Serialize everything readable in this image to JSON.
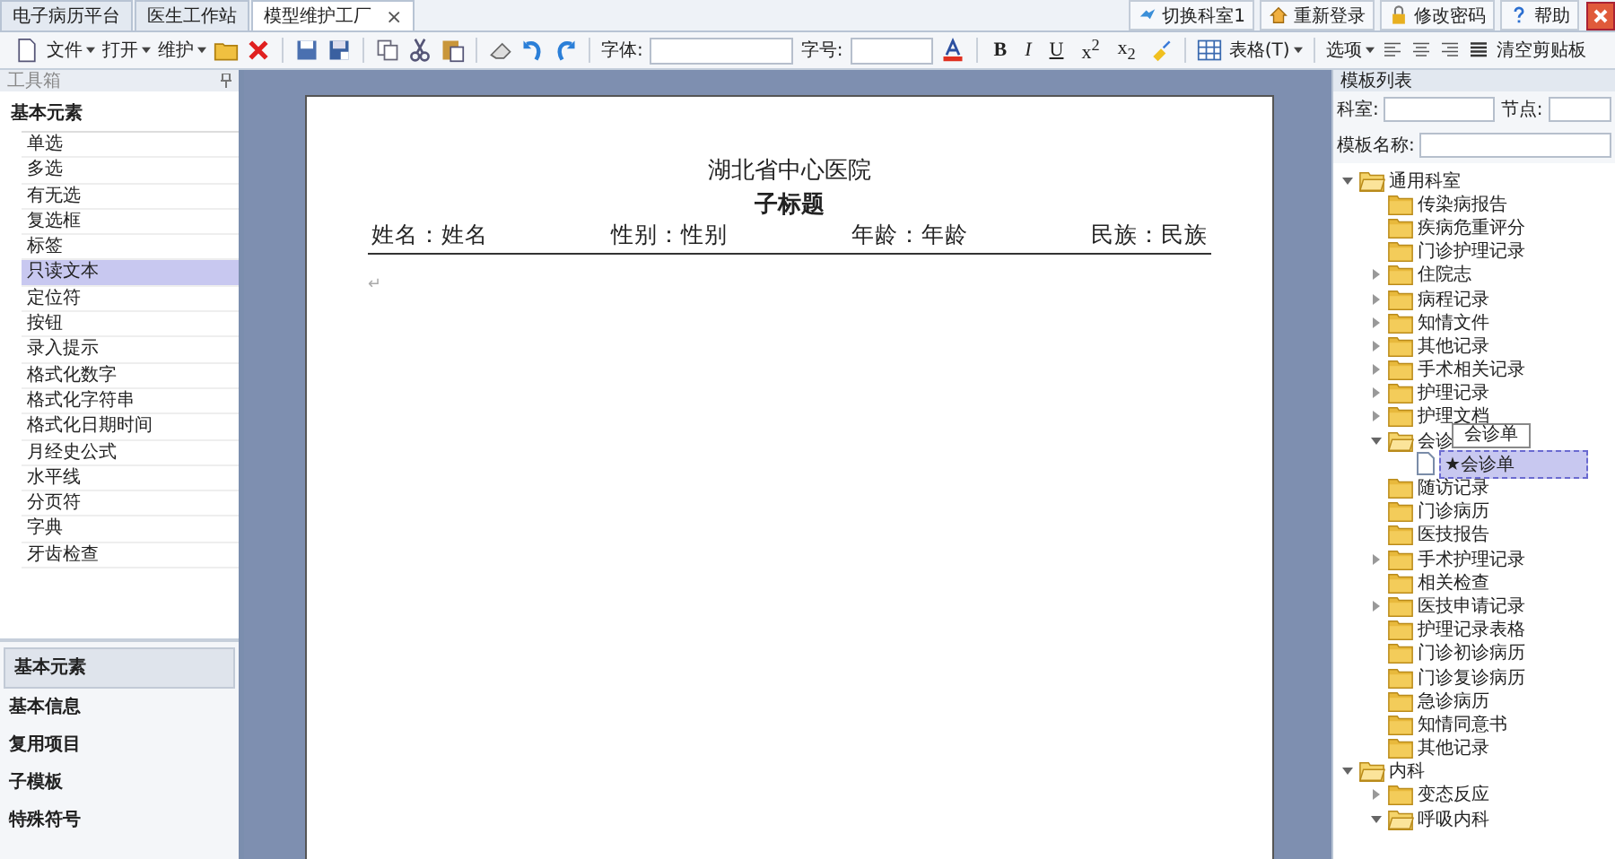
{
  "tabs": [
    {
      "label": "电子病历平台",
      "selected": false
    },
    {
      "label": "医生工作站",
      "selected": false
    },
    {
      "label": "模型维护工厂",
      "selected": true,
      "close": "×"
    }
  ],
  "top_buttons": [
    "切换科室1",
    "重新登录",
    "修改密码",
    "帮助"
  ],
  "toolbar": {
    "menus": [
      "文件",
      "打开",
      "维护"
    ],
    "font_label": "字体:",
    "size_label": "字号:",
    "format_glyphs": [
      "B",
      "I",
      "U",
      "x$^{2}$",
      "x$_{2}$"
    ],
    "table_menu": "表格(T)",
    "options_menu": "选项",
    "clear_clipboard": "清空剪贴板"
  },
  "toolbox": {
    "title": "工具箱",
    "section": "基本元素",
    "items": [
      {
        "label": "单选",
        "selected": false
      },
      {
        "label": "多选",
        "selected": false
      },
      {
        "label": "有无选",
        "selected": false
      },
      {
        "label": "复选框",
        "selected": false
      },
      {
        "label": "标签",
        "selected": false
      },
      {
        "label": "只读文本",
        "selected": true
      },
      {
        "label": "定位符",
        "selected": false
      },
      {
        "label": "按钮",
        "selected": false
      },
      {
        "label": "录入提示",
        "selected": false
      },
      {
        "label": "格式化数字",
        "selected": false
      },
      {
        "label": "格式化字符串",
        "selected": false
      },
      {
        "label": "格式化日期时间",
        "selected": false
      },
      {
        "label": "月经史公式",
        "selected": false
      },
      {
        "label": "水平线",
        "selected": false
      },
      {
        "label": "分页符",
        "selected": false
      },
      {
        "label": "字典",
        "selected": false
      },
      {
        "label": "牙齿检查",
        "selected": false
      }
    ],
    "nav": [
      {
        "label": "基本元素",
        "selected": true
      },
      {
        "label": "基本信息",
        "selected": false
      },
      {
        "label": "复用项目",
        "selected": false
      },
      {
        "label": "子模板",
        "selected": false
      },
      {
        "label": "特殊符号",
        "selected": false
      }
    ]
  },
  "document": {
    "title": "湖北省中心医院",
    "subtitle": "子标题",
    "fields": [
      "姓名：姓名",
      "性别：性别",
      "年龄：年龄",
      "民族：民族"
    ],
    "paragraph_mark": "↵"
  },
  "template_list": {
    "title": "模板列表",
    "dept_label": "科室:",
    "node_label": "节点:",
    "name_label": "模板名称:",
    "tree": [
      {
        "label": "通用科室",
        "kind": "folder",
        "expanded": true,
        "children": [
          {
            "label": "传染病报告",
            "kind": "folder"
          },
          {
            "label": "疾病危重评分",
            "kind": "folder"
          },
          {
            "label": "门诊护理记录",
            "kind": "folder"
          },
          {
            "label": "住院志",
            "kind": "folder",
            "expanded": false
          },
          {
            "label": "病程记录",
            "kind": "folder",
            "expanded": false
          },
          {
            "label": "知情文件",
            "kind": "folder",
            "expanded": false
          },
          {
            "label": "其他记录",
            "kind": "folder",
            "expanded": false
          },
          {
            "label": "手术相关记录",
            "kind": "folder",
            "expanded": false
          },
          {
            "label": "护理记录",
            "kind": "folder",
            "expanded": false
          },
          {
            "label": "护理文档",
            "kind": "folder",
            "expanded": false
          },
          {
            "label": "会诊",
            "kind": "folder",
            "expanded": true,
            "children": [
              {
                "label": "★会诊单",
                "kind": "document",
                "selected": true
              }
            ]
          },
          {
            "label": "随访记录",
            "kind": "folder"
          },
          {
            "label": "门诊病历",
            "kind": "folder"
          },
          {
            "label": "医技报告",
            "kind": "folder"
          },
          {
            "label": "手术护理记录",
            "kind": "folder",
            "expanded": false
          },
          {
            "label": "相关检查",
            "kind": "folder"
          },
          {
            "label": "医技申请记录",
            "kind": "folder",
            "expanded": false
          },
          {
            "label": "护理记录表格",
            "kind": "folder"
          },
          {
            "label": "门诊初诊病历",
            "kind": "folder"
          },
          {
            "label": "门诊复诊病历",
            "kind": "folder"
          },
          {
            "label": "急诊病历",
            "kind": "folder"
          },
          {
            "label": "知情同意书",
            "kind": "folder"
          },
          {
            "label": "其他记录",
            "kind": "folder"
          }
        ]
      },
      {
        "label": "内科",
        "kind": "folder",
        "expanded": true,
        "children": [
          {
            "label": "变态反应",
            "kind": "folder",
            "expanded": false
          },
          {
            "label": "呼吸内科",
            "kind": "folder",
            "expanded": true
          }
        ]
      }
    ],
    "tooltip": "会诊单"
  }
}
